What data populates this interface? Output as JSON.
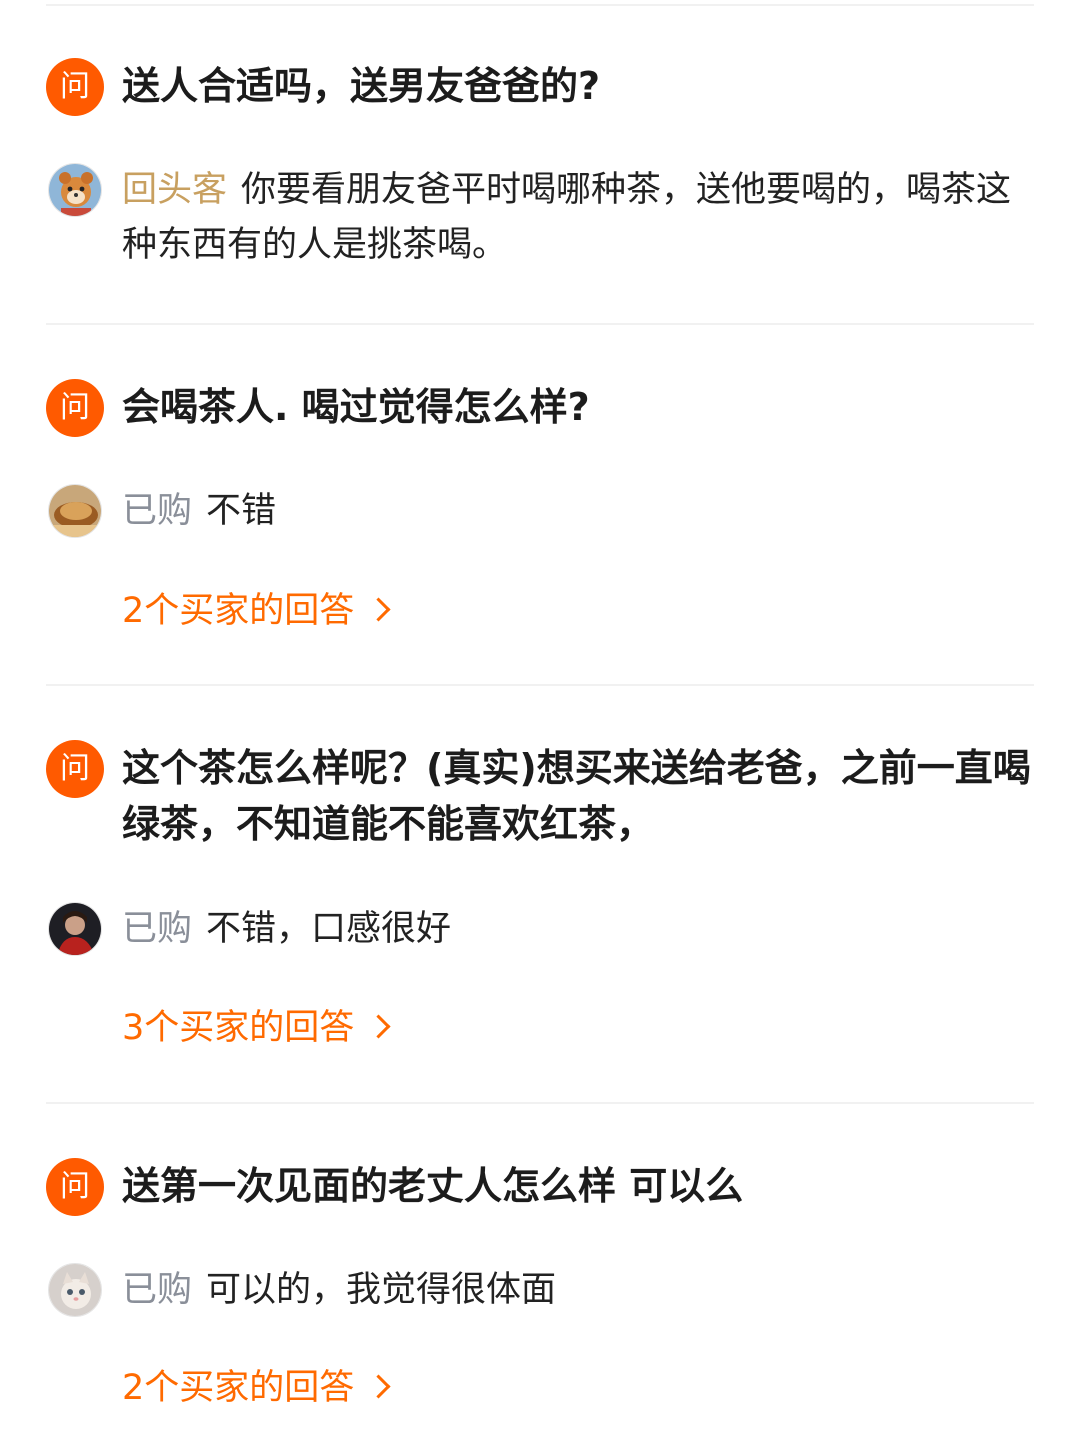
{
  "qa": [
    {
      "badge": "问",
      "question": "送人合适吗，送男友爸爸的?",
      "answer": {
        "author": "回头客",
        "text": "你要看朋友爸平时喝哪种茶，送他要喝的，喝茶这种东西有的人是挑茶喝。"
      }
    },
    {
      "badge": "问",
      "question": "会喝茶人. 喝过觉得怎么样?",
      "answer": {
        "tag": "已购",
        "text": "不错"
      },
      "more": "2个买家的回答"
    },
    {
      "badge": "问",
      "question": "这个茶怎么样呢？(真实)想买来送给老爸，之前一直喝绿茶，不知道能不能喜欢红茶，",
      "answer": {
        "tag": "已购",
        "text": "不错，口感很好"
      },
      "more": "3个买家的回答"
    },
    {
      "badge": "问",
      "question": "送第一次见面的老丈人怎么样 可以么",
      "answer": {
        "tag": "已购",
        "text": "可以的，我觉得很体面"
      },
      "more": "2个买家的回答"
    }
  ]
}
